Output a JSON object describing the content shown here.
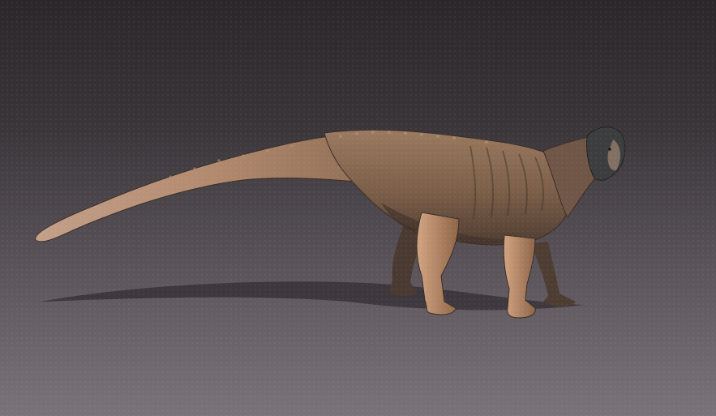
{
  "scene": {
    "subject": "quadrupedal-dinosaur",
    "background_colors": [
      "#2b272b",
      "#3a3539",
      "#5b555b",
      "#7a7379"
    ],
    "skin_colors": {
      "base": "#8a6a50",
      "light": "#c79a78",
      "dark": "#4a3a31",
      "head": "#3c3d3f"
    }
  }
}
